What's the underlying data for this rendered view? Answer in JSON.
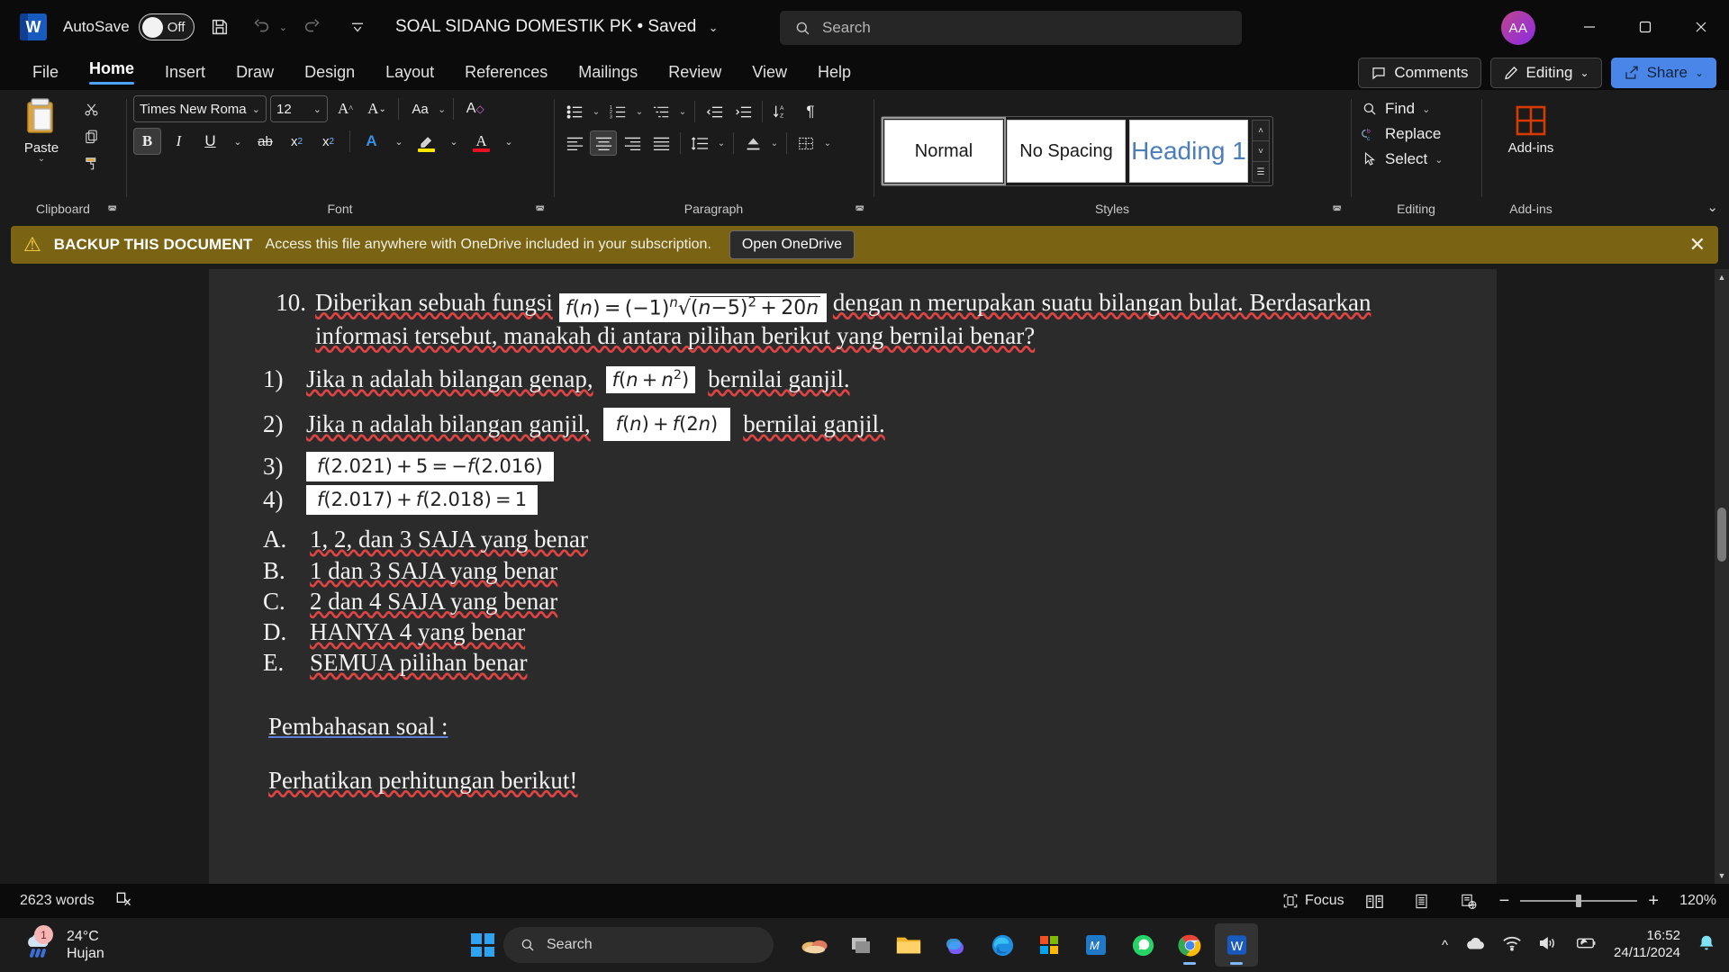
{
  "titlebar": {
    "app_icon": "word-logo",
    "autosave_label": "AutoSave",
    "autosave_state": "Off",
    "save_icon": "save-icon",
    "undo_icon": "undo-icon",
    "redo_icon": "redo-icon",
    "customize_qat_icon": "chevron-down-icon",
    "document_title": "SOAL SIDANG DOMESTIK PK • Saved",
    "title_chevron": "⌄",
    "search_placeholder": "Search",
    "search_icon": "search-icon",
    "account_initials": "AA",
    "minimize_label": "—",
    "maximize_label": "☐",
    "close_label": "✕"
  },
  "tabs": [
    {
      "label": "File",
      "active": false
    },
    {
      "label": "Home",
      "active": true
    },
    {
      "label": "Insert",
      "active": false
    },
    {
      "label": "Draw",
      "active": false
    },
    {
      "label": "Design",
      "active": false
    },
    {
      "label": "Layout",
      "active": false
    },
    {
      "label": "References",
      "active": false
    },
    {
      "label": "Mailings",
      "active": false
    },
    {
      "label": "Review",
      "active": false
    },
    {
      "label": "View",
      "active": false
    },
    {
      "label": "Help",
      "active": false
    }
  ],
  "tabs_right": {
    "comments_label": "Comments",
    "comments_icon": "comment-icon",
    "editing_label": "Editing",
    "editing_icon": "pencil-icon",
    "editing_chevron": "⌄",
    "share_label": "Share",
    "share_icon": "share-icon",
    "share_chevron": "⌄"
  },
  "ribbon": {
    "collapse_icon": "chevron-up-icon",
    "groups": {
      "clipboard": {
        "label": "Clipboard",
        "paste_label": "Paste",
        "paste_icon": "clipboard-icon",
        "paste_chevron": "⌄",
        "cut_icon": "scissors-icon",
        "copy_icon": "copy-icon",
        "format_painter_icon": "format-painter-icon",
        "dialog_launcher": "⤵"
      },
      "font": {
        "label": "Font",
        "font_name": "Times New Roman (H",
        "font_size": "12",
        "grow_font_icon": "grow-font-icon",
        "shrink_font_icon": "shrink-font-icon",
        "change_case_icon": "change-case-icon",
        "clear_formatting_icon": "clear-formatting-icon",
        "bold_label": "B",
        "italic_label": "I",
        "underline_label": "U",
        "strikethrough_label": "ab",
        "subscript_label": "x",
        "subscript_sub": "2",
        "superscript_label": "x",
        "superscript_sup": "2",
        "text_effects_icon": "text-effects-icon",
        "highlight_icon": "highlight-icon",
        "highlight_color": "#ffe600",
        "font_color_icon": "font-color-icon",
        "font_color": "#e81123",
        "dialog_launcher": "⤵",
        "bold_active": true
      },
      "paragraph": {
        "label": "Paragraph",
        "bullets_icon": "bullets-icon",
        "numbering_icon": "numbering-icon",
        "multilevel_icon": "multilevel-list-icon",
        "decrease_indent_icon": "decrease-indent-icon",
        "increase_indent_icon": "increase-indent-icon",
        "sort_icon": "sort-icon",
        "marks_icon": "paragraph-marks-icon",
        "align_left_icon": "align-left-icon",
        "align_center_icon": "align-center-icon",
        "align_right_icon": "align-right-icon",
        "justify_icon": "justify-icon",
        "line_spacing_icon": "line-spacing-icon",
        "shading_icon": "shading-icon",
        "borders_icon": "borders-icon",
        "dialog_launcher": "⤵"
      },
      "styles": {
        "label": "Styles",
        "cards": [
          {
            "name": "Normal",
            "selected": true
          },
          {
            "name": "No Spacing",
            "selected": false
          },
          {
            "name": "Heading 1",
            "selected": false
          }
        ],
        "scroll_up": "˄",
        "scroll_down": "˅",
        "more": "☷",
        "dialog_launcher": "⤵"
      },
      "editing": {
        "label": "Editing",
        "find_label": "Find",
        "find_icon": "search-icon",
        "find_chevron": "⌄",
        "replace_label": "Replace",
        "replace_icon": "replace-icon",
        "select_label": "Select",
        "select_icon": "cursor-icon",
        "select_chevron": "⌄"
      },
      "addins": {
        "label": "Add-ins",
        "button_label": "Add-ins",
        "icon": "addins-grid-icon",
        "color": "#d83b01"
      }
    }
  },
  "notification": {
    "warning_icon": "warning-icon",
    "title": "BACKUP THIS DOCUMENT",
    "message": "Access this file anywhere with OneDrive included in your subscription.",
    "action_label": "Open OneDrive",
    "close_icon": "close-icon",
    "background": "#7a6414"
  },
  "document": {
    "question": {
      "number": "10.",
      "text_before": "Diberikan sebuah fungsi",
      "formula": "f(n) = (−1)ⁿ√((n−5)² + 20n)",
      "text_after": "dengan n merupakan suatu bilangan bulat. Berdasarkan informasi tersebut, manakah di antara pilihan berikut yang bernilai benar?"
    },
    "statements": [
      {
        "num": "1)",
        "text_before": "Jika n adalah bilangan genap,",
        "formula": "f(n + n²)",
        "text_after": "bernilai ganjil."
      },
      {
        "num": "2)",
        "text_before": "Jika n adalah bilangan ganjil,",
        "formula": "f(n) + f(2n)",
        "text_after": "bernilai ganjil."
      },
      {
        "num": "3)",
        "text_before": "",
        "formula": "f(2.021) + 5 = −f(2.016)",
        "text_after": ""
      },
      {
        "num": "4)",
        "text_before": "",
        "formula": "f(2.017) + f(2.018) = 1",
        "text_after": ""
      }
    ],
    "answers": [
      {
        "label": "A.",
        "text": "1, 2, dan 3 SAJA yang benar"
      },
      {
        "label": "B.",
        "text": "1 dan 3 SAJA yang benar"
      },
      {
        "label": "C.",
        "text": "2 dan 4 SAJA yang benar"
      },
      {
        "label": "D.",
        "text": "HANYA 4 yang benar"
      },
      {
        "label": "E.",
        "text": "SEMUA pilihan benar"
      }
    ],
    "discussion_heading": "Pembahasan soal :",
    "discussion_line": "Perhatikan perhitungan berikut!"
  },
  "statusbar": {
    "word_count": "2623 words",
    "proofing_icon": "proofing-error-icon",
    "focus_label": "Focus",
    "focus_icon": "focus-icon",
    "read_mode_icon": "read-mode-icon",
    "print_layout_icon": "print-layout-icon",
    "web_layout_icon": "web-layout-icon",
    "zoom_out": "−",
    "zoom_in": "+",
    "zoom_level": "120%"
  },
  "taskbar": {
    "weather_badge": "1",
    "weather_temp": "24°C",
    "weather_desc": "Hujan",
    "weather_icon": "rain-icon",
    "start_icon": "windows-logo",
    "search_placeholder": "Search",
    "search_icon": "search-icon",
    "apps": [
      {
        "name": "widgets-icon",
        "active": false
      },
      {
        "name": "task-view-icon",
        "active": false
      },
      {
        "name": "file-explorer-icon",
        "active": false
      },
      {
        "name": "copilot-icon",
        "active": false
      },
      {
        "name": "edge-icon",
        "active": false
      },
      {
        "name": "microsoft-store-icon",
        "active": false
      },
      {
        "name": "excel-icon",
        "active": false
      },
      {
        "name": "whatsapp-icon",
        "active": false
      },
      {
        "name": "chrome-icon",
        "active": false
      },
      {
        "name": "word-icon",
        "active": true
      }
    ],
    "tray": {
      "expand_icon": "chevron-up-icon",
      "onedrive_icon": "cloud-icon",
      "wifi_icon": "wifi-icon",
      "volume_icon": "speaker-icon",
      "battery_icon": "battery-saver-icon",
      "time": "16:52",
      "date": "24/11/2024",
      "notification_icon": "bell-icon"
    }
  }
}
